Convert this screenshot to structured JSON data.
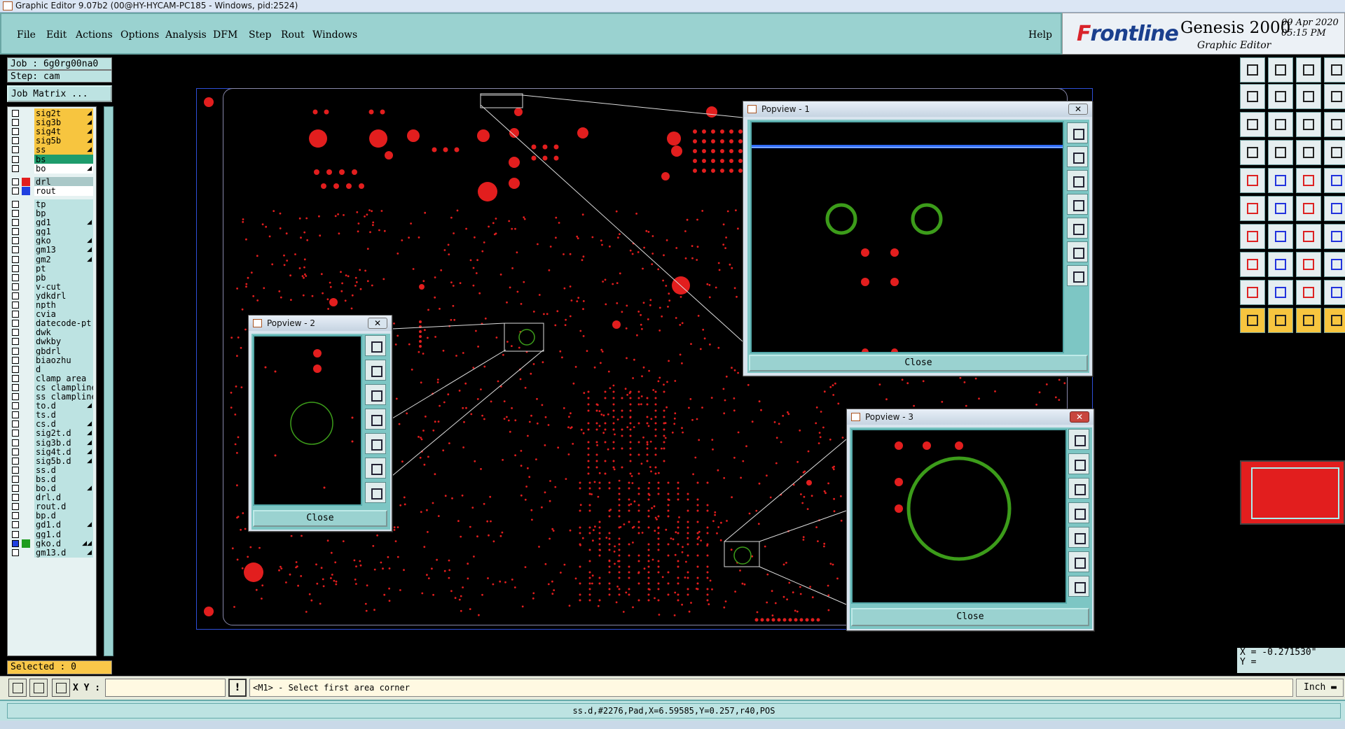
{
  "window": {
    "title": "Graphic Editor 9.07b2 (00@HY-HYCAM-PC185 - Windows, pid:2524)"
  },
  "menu": [
    "File",
    "Edit",
    "Actions",
    "Options",
    "Analysis",
    "DFM",
    "Step",
    "Rout",
    "Windows"
  ],
  "help_label": "Help",
  "brand": {
    "logo_prefix": "F",
    "logo_rest": "rontline",
    "product": "Genesis 2000",
    "subtitle": "Graphic Editor",
    "date": "09 Apr 2020",
    "time": "05:15 PM"
  },
  "job": {
    "job_label": "Job : 6g0rg00na0",
    "step_label": "Step: cam",
    "matrix_button": "Job Matrix ..."
  },
  "layers": [
    {
      "name": "sig2t",
      "color": "#f7c53f",
      "flag": "◢"
    },
    {
      "name": "sig3b",
      "color": "#f7c53f",
      "flag": "◢"
    },
    {
      "name": "sig4t",
      "color": "#f7c53f",
      "flag": "◢"
    },
    {
      "name": "sig5b",
      "color": "#f7c53f",
      "flag": "◢"
    },
    {
      "name": "ss",
      "color": "#f7c53f",
      "flag": "◢"
    },
    {
      "name": "bs",
      "color": "#1e9c6c",
      "flag": ""
    },
    {
      "name": "bo",
      "color": "#ffffff",
      "flag": "◢"
    },
    {
      "name": "drl",
      "color": "#aac8c8",
      "flag": "",
      "swatch": "#e21e1e"
    },
    {
      "name": "rout",
      "color": "#ffffff",
      "flag": "",
      "swatch": "#2040e0"
    },
    {
      "name": "tp",
      "color": "#bde3e2",
      "flag": ""
    },
    {
      "name": "bp",
      "color": "#bde3e2",
      "flag": ""
    },
    {
      "name": "gd1",
      "color": "#bde3e2",
      "flag": "◢"
    },
    {
      "name": "gg1",
      "color": "#bde3e2",
      "flag": ""
    },
    {
      "name": "gko",
      "color": "#bde3e2",
      "flag": "◢"
    },
    {
      "name": "gm13",
      "color": "#bde3e2",
      "flag": "◢"
    },
    {
      "name": "gm2",
      "color": "#bde3e2",
      "flag": "◢"
    },
    {
      "name": "pt",
      "color": "#bde3e2",
      "flag": ""
    },
    {
      "name": "pb",
      "color": "#bde3e2",
      "flag": ""
    },
    {
      "name": "v-cut",
      "color": "#bde3e2",
      "flag": ""
    },
    {
      "name": "ydkdrl",
      "color": "#bde3e2",
      "flag": ""
    },
    {
      "name": "npth",
      "color": "#bde3e2",
      "flag": ""
    },
    {
      "name": "cvia",
      "color": "#bde3e2",
      "flag": ""
    },
    {
      "name": "datecode-pt",
      "color": "#bde3e2",
      "flag": ""
    },
    {
      "name": "dwk",
      "color": "#bde3e2",
      "flag": ""
    },
    {
      "name": "dwkby",
      "color": "#bde3e2",
      "flag": ""
    },
    {
      "name": "gbdrl",
      "color": "#bde3e2",
      "flag": ""
    },
    {
      "name": "biaozhu",
      "color": "#bde3e2",
      "flag": ""
    },
    {
      "name": "d",
      "color": "#bde3e2",
      "flag": ""
    },
    {
      "name": "clamp_area",
      "color": "#bde3e2",
      "flag": ""
    },
    {
      "name": "cs_clampline",
      "color": "#bde3e2",
      "flag": ""
    },
    {
      "name": "ss_clampline",
      "color": "#bde3e2",
      "flag": ""
    },
    {
      "name": "to.d",
      "color": "#bde3e2",
      "flag": "◢"
    },
    {
      "name": "ts.d",
      "color": "#bde3e2",
      "flag": ""
    },
    {
      "name": "cs.d",
      "color": "#bde3e2",
      "flag": "◢"
    },
    {
      "name": "sig2t.d",
      "color": "#bde3e2",
      "flag": "◢"
    },
    {
      "name": "sig3b.d",
      "color": "#bde3e2",
      "flag": "◢"
    },
    {
      "name": "sig4t.d",
      "color": "#bde3e2",
      "flag": "◢"
    },
    {
      "name": "sig5b.d",
      "color": "#bde3e2",
      "flag": "◢"
    },
    {
      "name": "ss.d",
      "color": "#bde3e2",
      "flag": ""
    },
    {
      "name": "bs.d",
      "color": "#bde3e2",
      "flag": ""
    },
    {
      "name": "bo.d",
      "color": "#bde3e2",
      "flag": "◢"
    },
    {
      "name": "drl.d",
      "color": "#bde3e2",
      "flag": ""
    },
    {
      "name": "rout.d",
      "color": "#bde3e2",
      "flag": ""
    },
    {
      "name": "bp.d",
      "color": "#bde3e2",
      "flag": ""
    },
    {
      "name": "gd1.d",
      "color": "#bde3e2",
      "flag": "◢"
    },
    {
      "name": "gg1.d",
      "color": "#bde3e2",
      "flag": ""
    },
    {
      "name": "gko.d",
      "color": "#bde3e2",
      "flag": "◢◢",
      "swatch": "#1e9c1e",
      "checked": true
    },
    {
      "name": "gm13.d",
      "color": "#bde3e2",
      "flag": "◢"
    }
  ],
  "selected_label": "Selected : 0",
  "popviews": [
    {
      "title": "Popview - 1",
      "close_label": "Close"
    },
    {
      "title": "Popview - 2",
      "close_label": "Close"
    },
    {
      "title": "Popview - 3",
      "close_label": "Close"
    }
  ],
  "coords": {
    "x": "X = -0.271530\"",
    "y": "Y = "
  },
  "bottom": {
    "xy_label": "X Y :",
    "xy_value": "",
    "message": "<M1> - Select first area corner",
    "unit": "Inch"
  },
  "status": "ss.d,#2276,Pad,X=6.59585,Y=0.257,r40,POS",
  "colors": {
    "pad": "#e21e1e",
    "drill_ring": "#3c9c1a",
    "menu_bg": "#9ad2d0",
    "panel_bg": "#bde3e2"
  }
}
